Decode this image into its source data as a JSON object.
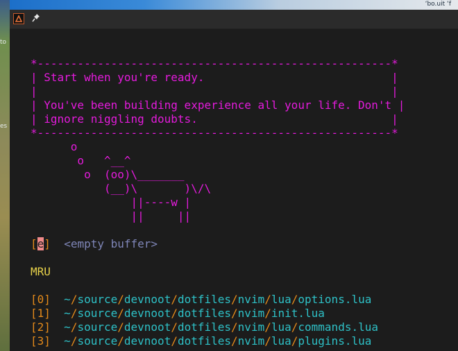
{
  "desktop": {
    "left_labels": [
      "to",
      "es"
    ],
    "top_right_text": "ʻbo.uit ʻf"
  },
  "window": {
    "app_icon": "alacritty-icon",
    "pin_icon": "pin-icon"
  },
  "startify": {
    "box": {
      "top": "*-----------------------------------------------------*",
      "rows": [
        "| Start when you're ready.                            |",
        "|                                                     |",
        "| You've been building experience all your life. Don't |",
        "| ignore niggling doubts.                             |"
      ],
      "bottom": "*-----------------------------------------------------*"
    },
    "cow": [
      "      o",
      "       o   ^__^",
      "        o  (oo)\\_______",
      "           (__)\\       )\\/\\",
      "               ||----w |",
      "               ||     ||"
    ],
    "empty_entry": {
      "open": "[",
      "key": "e",
      "close": "]",
      "label": "<empty buffer>"
    },
    "mru_header": "MRU",
    "mru": [
      {
        "key": "[0]",
        "tilde": "~",
        "parts": [
          "source",
          "devnoot",
          "dotfiles",
          "nvim",
          "lua",
          "options.lua"
        ]
      },
      {
        "key": "[1]",
        "tilde": "~",
        "parts": [
          "source",
          "devnoot",
          "dotfiles",
          "nvim",
          "init.lua"
        ]
      },
      {
        "key": "[2]",
        "tilde": "~",
        "parts": [
          "source",
          "devnoot",
          "dotfiles",
          "nvim",
          "lua",
          "commands.lua"
        ]
      },
      {
        "key": "[3]",
        "tilde": "~",
        "parts": [
          "source",
          "devnoot",
          "dotfiles",
          "nvim",
          "lua",
          "plugins.lua"
        ]
      }
    ]
  },
  "colors": {
    "header": "#e41bdc",
    "key": "#e48a1a",
    "path": "#2ec1c7",
    "section": "#e8d24a",
    "background": "#1c1c1c"
  }
}
